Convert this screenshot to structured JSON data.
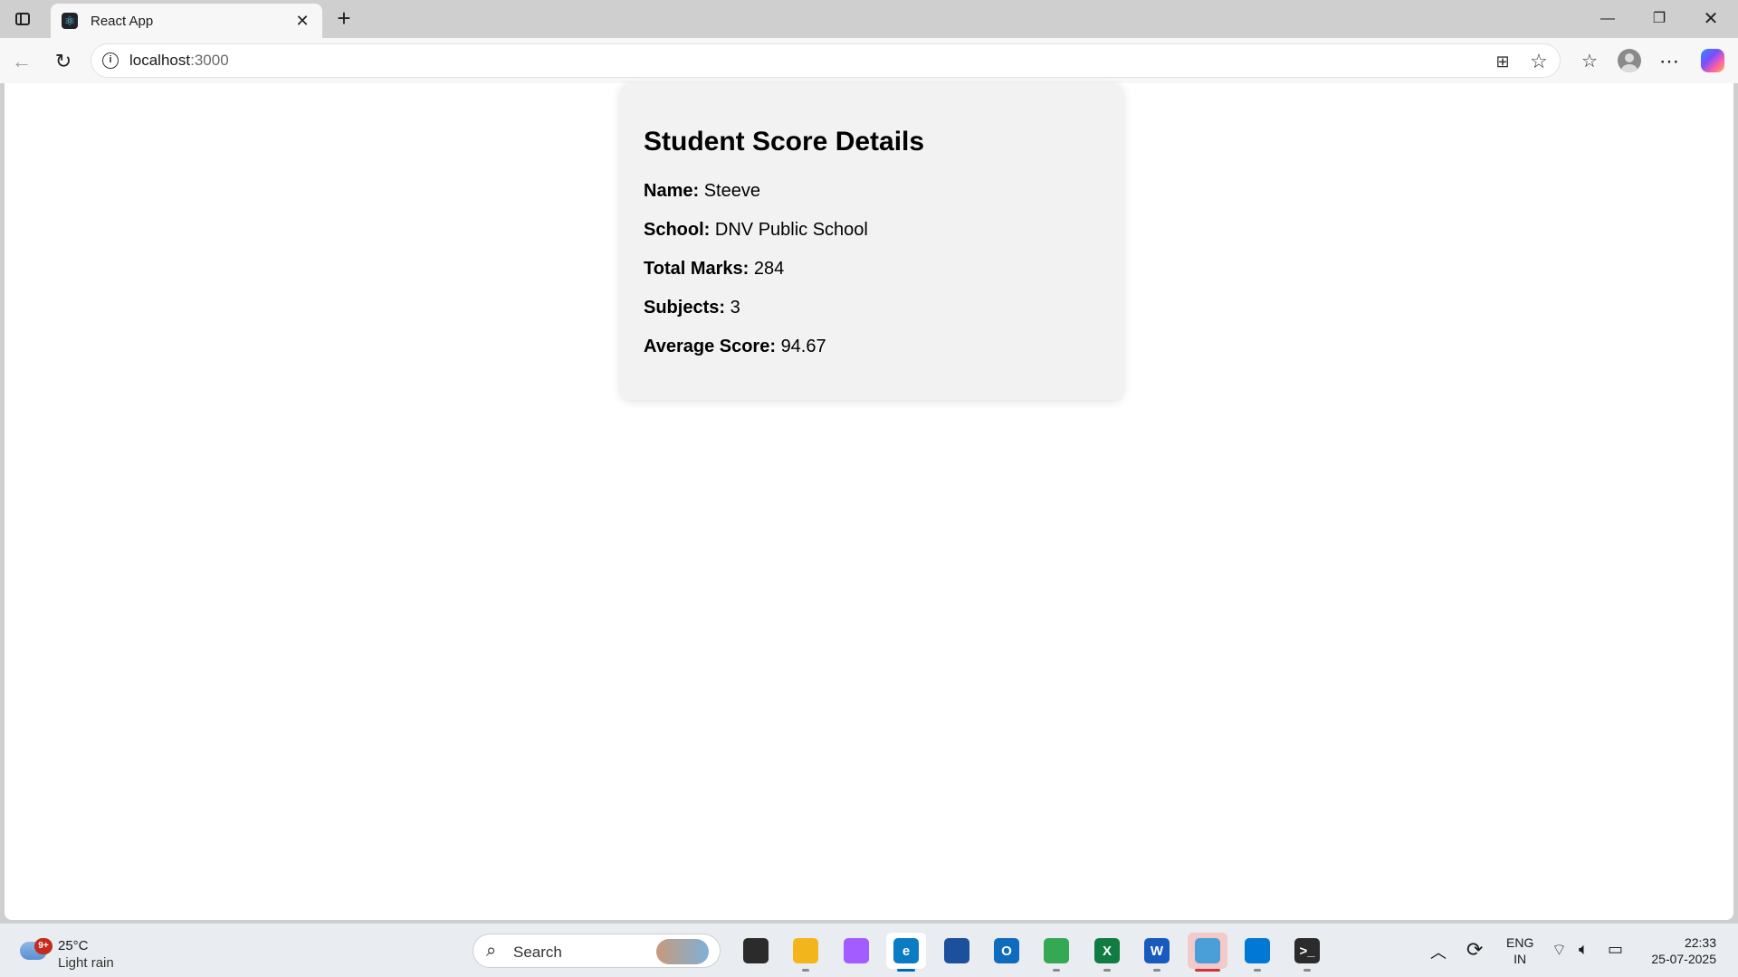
{
  "browser": {
    "tab_title": "React App",
    "tab_favicon": "react-logo-icon",
    "url_host": "localhost",
    "url_port": ":3000"
  },
  "page": {
    "heading": "Student Score Details",
    "fields": [
      {
        "label": "Name:",
        "value": "Steeve"
      },
      {
        "label": "School:",
        "value": "DNV Public School"
      },
      {
        "label": "Total Marks:",
        "value": "284"
      },
      {
        "label": "Subjects:",
        "value": "3"
      },
      {
        "label": "Average Score:",
        "value": "94.67"
      }
    ]
  },
  "taskbar": {
    "weather_badge": "9+",
    "weather_temp": "25°C",
    "weather_desc": "Light rain",
    "search_placeholder": "Search",
    "lang_line1": "ENG",
    "lang_line2": "IN",
    "time": "22:33",
    "date": "25-07-2025",
    "apps": [
      {
        "name": "task-view",
        "glyph": "",
        "color": "#2b2b2b"
      },
      {
        "name": "file-explorer",
        "glyph": "",
        "color": "#f2b51c"
      },
      {
        "name": "copilot",
        "glyph": "",
        "color": "#a25cff"
      },
      {
        "name": "edge",
        "glyph": "e",
        "color": "#0a7cc4"
      },
      {
        "name": "microsoft-store",
        "glyph": "",
        "color": "#1c4f9c"
      },
      {
        "name": "outlook",
        "glyph": "O",
        "color": "#0f6cbd"
      },
      {
        "name": "chrome",
        "glyph": "",
        "color": "#34a853"
      },
      {
        "name": "excel",
        "glyph": "X",
        "color": "#107c41"
      },
      {
        "name": "word",
        "glyph": "W",
        "color": "#185abd"
      },
      {
        "name": "remote-desktop",
        "glyph": "",
        "color": "#4b9fd8"
      },
      {
        "name": "vscode",
        "glyph": "",
        "color": "#0078d4"
      },
      {
        "name": "terminal",
        "glyph": ">_",
        "color": "#2b2b2b"
      }
    ]
  }
}
